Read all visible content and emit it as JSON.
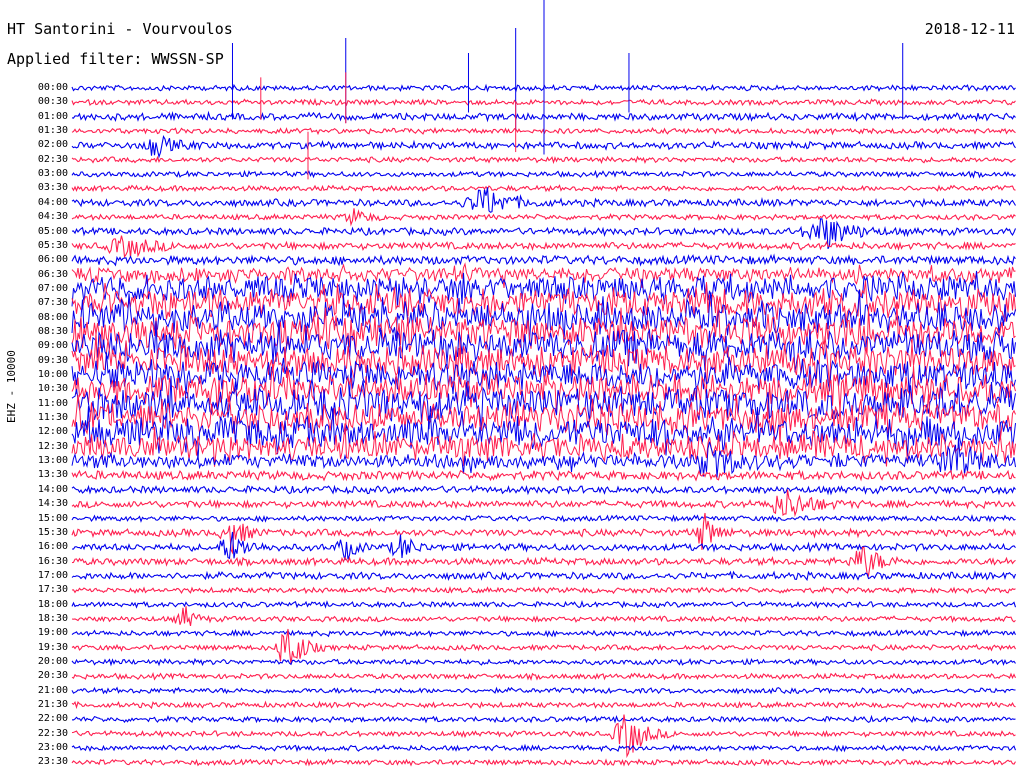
{
  "header": {
    "station": "HT Santorini - Vourvoulos",
    "filter": "Applied filter: WWSSN-SP",
    "date": "2018-12-11"
  },
  "chart_data": {
    "type": "line",
    "title": "HT Santorini - Vourvoulos",
    "subtitle": "Applied filter: WWSSN-SP",
    "date": "2018-12-11",
    "ylabel": "EHZ - 10000",
    "row_labels": [
      "00:00",
      "00:30",
      "01:00",
      "01:30",
      "02:00",
      "02:30",
      "03:00",
      "03:30",
      "04:00",
      "04:30",
      "05:00",
      "05:30",
      "06:00",
      "06:30",
      "07:00",
      "07:30",
      "08:00",
      "08:30",
      "09:00",
      "09:30",
      "10:00",
      "10:30",
      "11:00",
      "11:30",
      "12:00",
      "12:30",
      "13:00",
      "13:30",
      "14:00",
      "14:30",
      "15:00",
      "15:30",
      "16:00",
      "16:30",
      "17:00",
      "17:30",
      "18:00",
      "18:30",
      "19:00",
      "19:30",
      "20:00",
      "20:30",
      "21:00",
      "21:30",
      "22:00",
      "22:30",
      "23:00",
      "23:30"
    ],
    "series_colors": [
      "#0000ee",
      "#ff1f4f"
    ],
    "row_amplitude": [
      3,
      3,
      4,
      3,
      4,
      3,
      3,
      3,
      4,
      3,
      4,
      4,
      5,
      8,
      14,
      16,
      17,
      18,
      18,
      17,
      16,
      17,
      18,
      17,
      17,
      14,
      8,
      5,
      4,
      4,
      3,
      4,
      4,
      4,
      4,
      3,
      3,
      3,
      3,
      3,
      3,
      3,
      3,
      3,
      3,
      3,
      3,
      3
    ],
    "events": [
      {
        "row": 4,
        "pos": 0.09,
        "amp": 10,
        "width": 0.02
      },
      {
        "row": 8,
        "pos": 0.44,
        "amp": 14,
        "width": 0.03
      },
      {
        "row": 9,
        "pos": 0.3,
        "amp": 8,
        "width": 0.015
      },
      {
        "row": 10,
        "pos": 0.8,
        "amp": 16,
        "width": 0.03
      },
      {
        "row": 11,
        "pos": 0.06,
        "amp": 10,
        "width": 0.03
      },
      {
        "row": 26,
        "pos": 0.68,
        "amp": 14,
        "width": 0.03
      },
      {
        "row": 26,
        "pos": 0.94,
        "amp": 14,
        "width": 0.03
      },
      {
        "row": 29,
        "pos": 0.76,
        "amp": 14,
        "width": 0.03
      },
      {
        "row": 31,
        "pos": 0.17,
        "amp": 18,
        "width": 0.015
      },
      {
        "row": 31,
        "pos": 0.67,
        "amp": 18,
        "width": 0.015
      },
      {
        "row": 32,
        "pos": 0.17,
        "amp": 14,
        "width": 0.02
      },
      {
        "row": 32,
        "pos": 0.29,
        "amp": 12,
        "width": 0.012
      },
      {
        "row": 32,
        "pos": 0.35,
        "amp": 12,
        "width": 0.015
      },
      {
        "row": 33,
        "pos": 0.84,
        "amp": 16,
        "width": 0.02
      },
      {
        "row": 37,
        "pos": 0.12,
        "amp": 12,
        "width": 0.012
      },
      {
        "row": 39,
        "pos": 0.23,
        "amp": 32,
        "width": 0.015
      },
      {
        "row": 45,
        "pos": 0.59,
        "amp": 24,
        "width": 0.02
      }
    ],
    "spikes": [
      {
        "row": 0,
        "pos": 0.5,
        "amp": 95
      },
      {
        "row": 0,
        "pos": 0.47,
        "amp": 60
      },
      {
        "row": 0,
        "pos": 0.17,
        "amp": 45
      },
      {
        "row": 0,
        "pos": 0.29,
        "amp": 50
      },
      {
        "row": 0,
        "pos": 0.59,
        "amp": 35
      },
      {
        "row": 0,
        "pos": 0.88,
        "amp": 45
      },
      {
        "row": 0,
        "pos": 0.42,
        "amp": 35
      },
      {
        "row": 1,
        "pos": 0.29,
        "amp": 30
      },
      {
        "row": 1,
        "pos": 0.2,
        "amp": 25
      },
      {
        "row": 3,
        "pos": 0.47,
        "amp": 30
      },
      {
        "row": 5,
        "pos": 0.25,
        "amp": 28
      }
    ]
  }
}
